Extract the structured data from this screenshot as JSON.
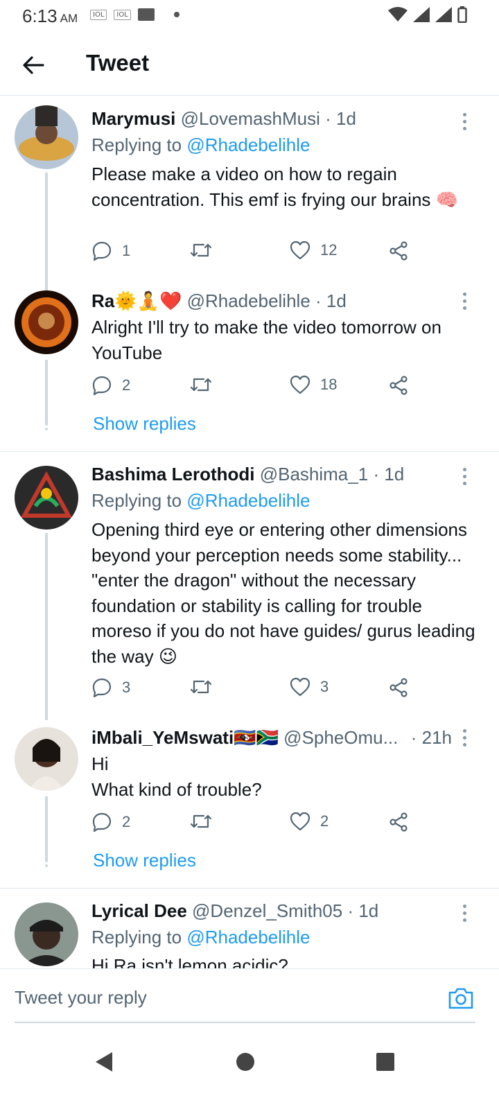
{
  "status_bar": {
    "time": "6:13",
    "ampm": "AM",
    "sim1": "IOL",
    "sim2": "IOL"
  },
  "header": {
    "title": "Tweet"
  },
  "tweets": [
    {
      "name": "Marymusi",
      "handle": "@LovemashMusi",
      "time": "· 1d",
      "replying_label": "Replying to",
      "replying_to": "@Rhadebelihle",
      "text": "Please make a video on how to regain concentration. This emf is frying our brains 🧠",
      "replies": "1",
      "retweets": "",
      "likes": "12"
    },
    {
      "name": "Ra🌞🧘❤️",
      "handle": "@Rhadebelihle",
      "time": "· 1d",
      "text": "Alright I'll try to make the video tomorrow on YouTube",
      "replies": "2",
      "retweets": "",
      "likes": "18",
      "show_replies": "Show replies"
    },
    {
      "name": "Bashima Lerothodi",
      "handle": "@Bashima_1",
      "time": "· 1d",
      "replying_label": "Replying to",
      "replying_to": "@Rhadebelihle",
      "text": "Opening third eye or entering other dimensions beyond your perception needs some stability... \"enter the dragon\" without the necessary foundation or stability is calling for trouble moreso if you do not have guides/ gurus leading the way 😉",
      "replies": "3",
      "retweets": "",
      "likes": "3"
    },
    {
      "name": "iMbali_YeMswati🇸🇿🇿🇦",
      "handle": "@SpheOmu...",
      "time": "· 21h",
      "text_line1": "Hi",
      "text_line2": "What kind of trouble?",
      "replies": "2",
      "retweets": "",
      "likes": "2",
      "show_replies": "Show replies"
    },
    {
      "name": "Lyrical Dee",
      "handle": "@Denzel_Smith05",
      "time": "· 1d",
      "replying_label": "Replying to",
      "replying_to": "@Rhadebelihle",
      "text": "Hi Ra isn't lemon acidic?"
    }
  ],
  "reply_bar": {
    "placeholder": "Tweet your reply"
  },
  "icons": {
    "back": "arrow-left-icon",
    "reply": "comment-icon",
    "retweet": "retweet-icon",
    "like": "heart-icon",
    "share": "share-icon",
    "more": "more-vertical-icon",
    "camera": "camera-icon"
  },
  "colors": {
    "accent": "#1d9bf0",
    "text": "#0f1419",
    "secondary": "#536471",
    "divider": "#e1e8ed"
  }
}
